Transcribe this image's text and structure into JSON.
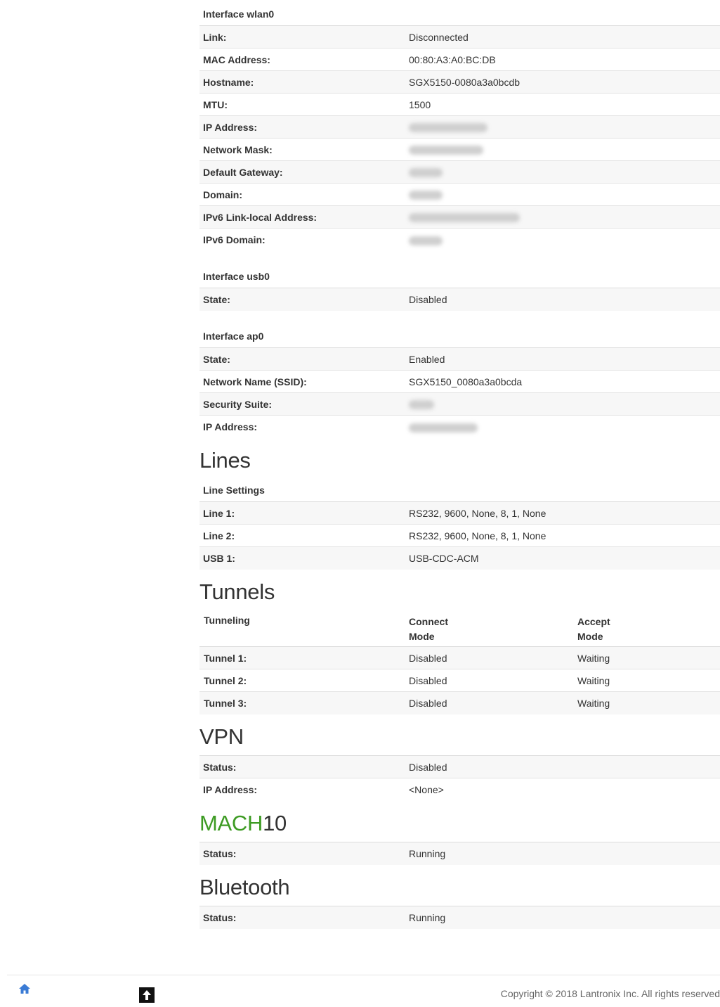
{
  "wlan0": {
    "header": "Interface wlan0",
    "rows": [
      {
        "label": "Link:",
        "value": "Disconnected"
      },
      {
        "label": "MAC Address:",
        "value": "00:80:A3:A0:BC:DB"
      },
      {
        "label": "Hostname:",
        "value": "SGX5150-0080a3a0bcdb"
      },
      {
        "label": "MTU:",
        "value": "1500"
      },
      {
        "label": "IP Address:",
        "value": ""
      },
      {
        "label": "Network Mask:",
        "value": ""
      },
      {
        "label": "Default Gateway:",
        "value": ""
      },
      {
        "label": "Domain:",
        "value": ""
      },
      {
        "label": "IPv6 Link-local Address:",
        "value": ""
      },
      {
        "label": "IPv6 Domain:",
        "value": ""
      }
    ]
  },
  "usb0": {
    "header": "Interface usb0",
    "rows": [
      {
        "label": "State:",
        "value": "Disabled"
      }
    ]
  },
  "ap0": {
    "header": "Interface ap0",
    "rows": [
      {
        "label": "State:",
        "value": "Enabled"
      },
      {
        "label": "Network Name (SSID):",
        "value": "SGX5150_0080a3a0bcda"
      },
      {
        "label": "Security Suite:",
        "value": ""
      },
      {
        "label": "IP Address:",
        "value": ""
      }
    ]
  },
  "lines": {
    "title": "Lines",
    "header": "Line Settings",
    "rows": [
      {
        "label": "Line 1:",
        "value": "RS232, 9600, None, 8, 1, None"
      },
      {
        "label": "Line 2:",
        "value": "RS232, 9600, None, 8, 1, None"
      },
      {
        "label": "USB 1:",
        "value": "USB-CDC-ACM"
      }
    ]
  },
  "tunnels": {
    "title": "Tunnels",
    "col1": "Tunneling",
    "col2_line1": "Connect",
    "col2_line2": "Mode",
    "col3_line1": "Accept",
    "col3_line2": "Mode",
    "rows": [
      {
        "label": "Tunnel 1:",
        "connect": "Disabled",
        "accept": "Waiting"
      },
      {
        "label": "Tunnel 2:",
        "connect": "Disabled",
        "accept": "Waiting"
      },
      {
        "label": "Tunnel 3:",
        "connect": "Disabled",
        "accept": "Waiting"
      }
    ]
  },
  "vpn": {
    "title": "VPN",
    "rows": [
      {
        "label": "Status:",
        "value": "Disabled"
      },
      {
        "label": "IP Address:",
        "value": "<None>"
      }
    ]
  },
  "mach10": {
    "title_green": "MACH",
    "title_rest": "10",
    "green_color": "#3d9b23",
    "rows": [
      {
        "label": "Status:",
        "value": "Running"
      }
    ]
  },
  "bluetooth": {
    "title": "Bluetooth",
    "rows": [
      {
        "label": "Status:",
        "value": "Running"
      }
    ]
  },
  "footer": {
    "copyright": "Copyright © 2018 Lantronix Inc. All rights reserved",
    "home_icon": "home-icon",
    "top_icon": "arrow-up-icon"
  }
}
